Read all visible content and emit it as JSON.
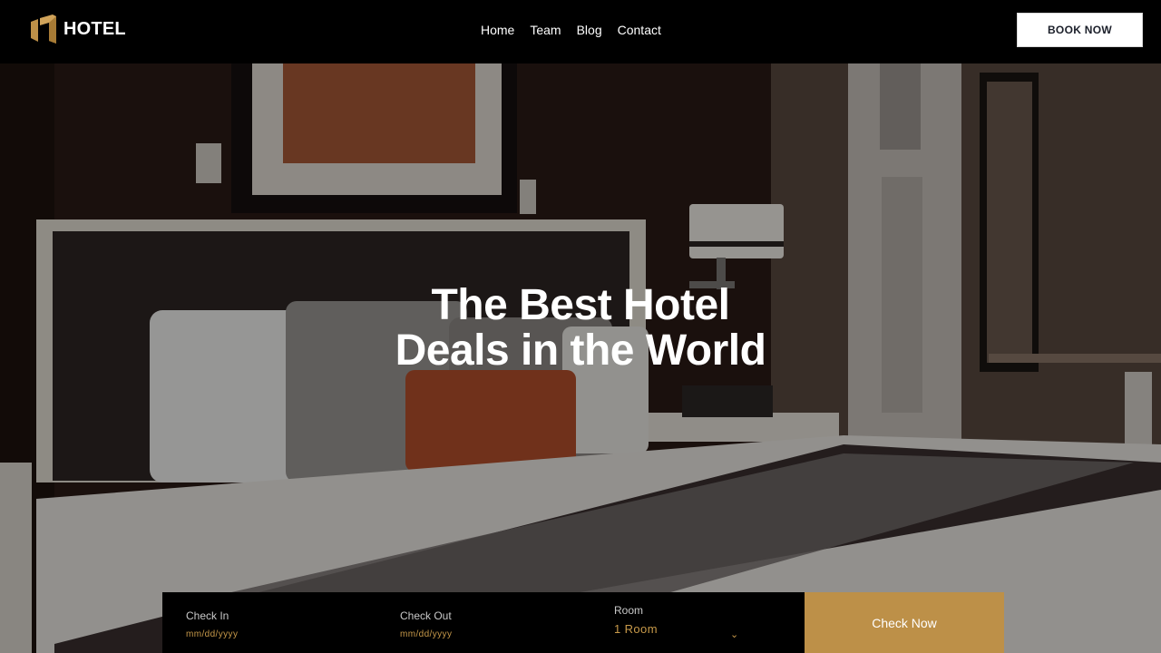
{
  "brand": {
    "name": "HOTEL",
    "accent": "#bd9048"
  },
  "nav": {
    "items": [
      "Home",
      "Team",
      "Blog",
      "Contact"
    ]
  },
  "header": {
    "book_label": "BOOK NOW"
  },
  "hero": {
    "title_line1": "The Best Hotel",
    "title_line2": "Deals in the World"
  },
  "booking": {
    "check_in": {
      "label": "Check In",
      "placeholder": "mm/dd/yyyy"
    },
    "check_out": {
      "label": "Check Out",
      "placeholder": "mm/dd/yyyy"
    },
    "room": {
      "label": "Room",
      "value": "1 Room",
      "icon": "chevron-down-icon"
    },
    "submit_label": "Check Now"
  }
}
